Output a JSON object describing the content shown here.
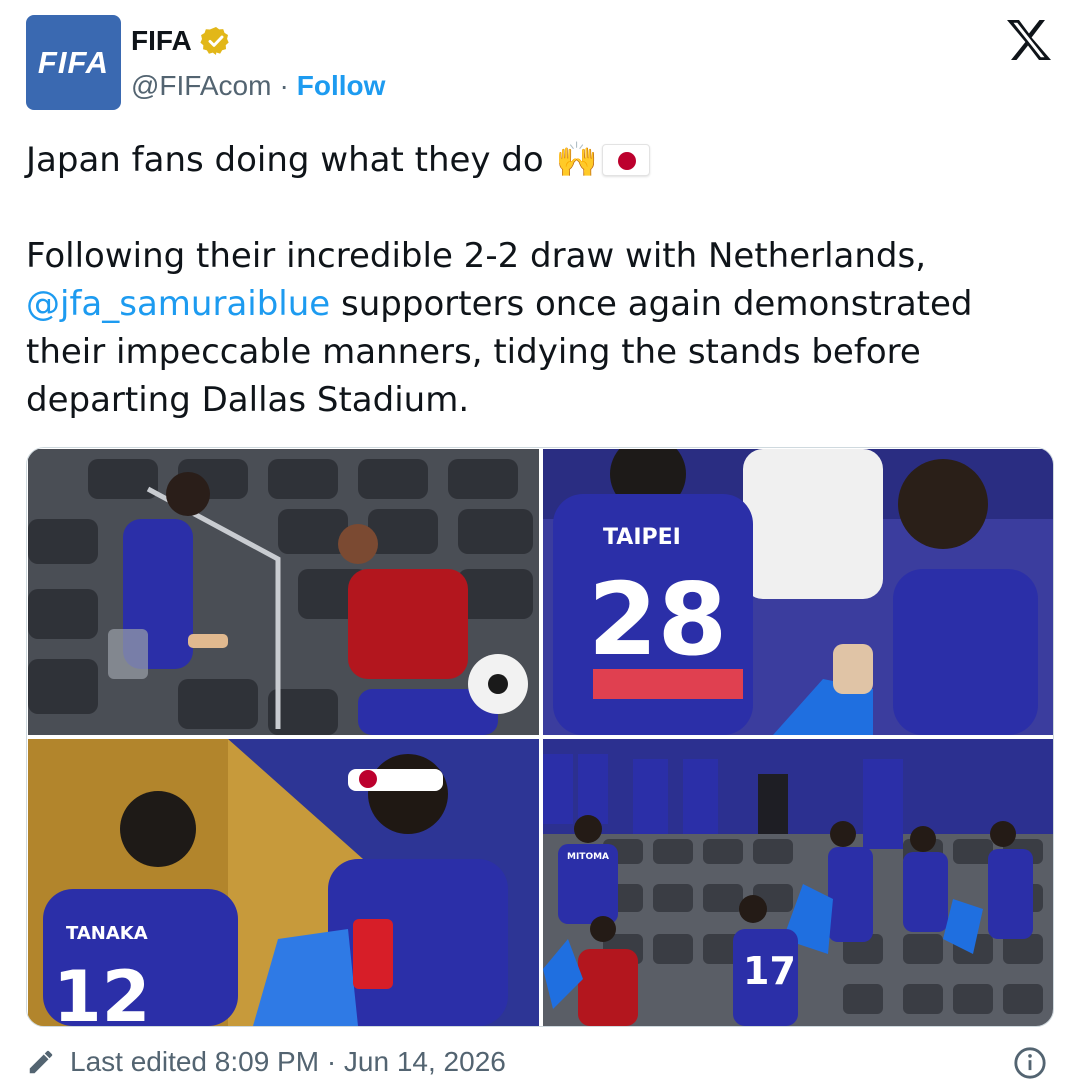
{
  "account": {
    "avatar_text": "FIFA",
    "display_name": "FIFA",
    "handle": "@FIFAcom",
    "separator": "·",
    "follow_label": "Follow",
    "avatar_color": "#3a69b1",
    "verified_color": "#e2b719"
  },
  "tweet": {
    "line1": "Japan fans doing what they do",
    "emoji_hands": "🙌",
    "emoji_flag": "japan-flag",
    "para_prefix": "Following their incredible 2-2 draw with Netherlands,",
    "mention": "@jfa_samuraiblue",
    "para_suffix": "supporters once again demonstrated their impeccable manners, tidying the stands before departing Dallas Stadium."
  },
  "media": {
    "photos": [
      {
        "jersey_text": ""
      },
      {
        "jersey_text": "TAIPEI",
        "number": "28"
      },
      {
        "jersey_text": "TANAKA",
        "number": "12"
      },
      {
        "jersey_text": "MITOMA",
        "number": "17"
      }
    ]
  },
  "footer": {
    "edited_text": "Last edited 8:09 PM · Jun 14, 2026"
  },
  "colors": {
    "link": "#1d9bf0",
    "text": "#0f1419",
    "muted": "#536471",
    "jersey": "#2b2fa8"
  }
}
